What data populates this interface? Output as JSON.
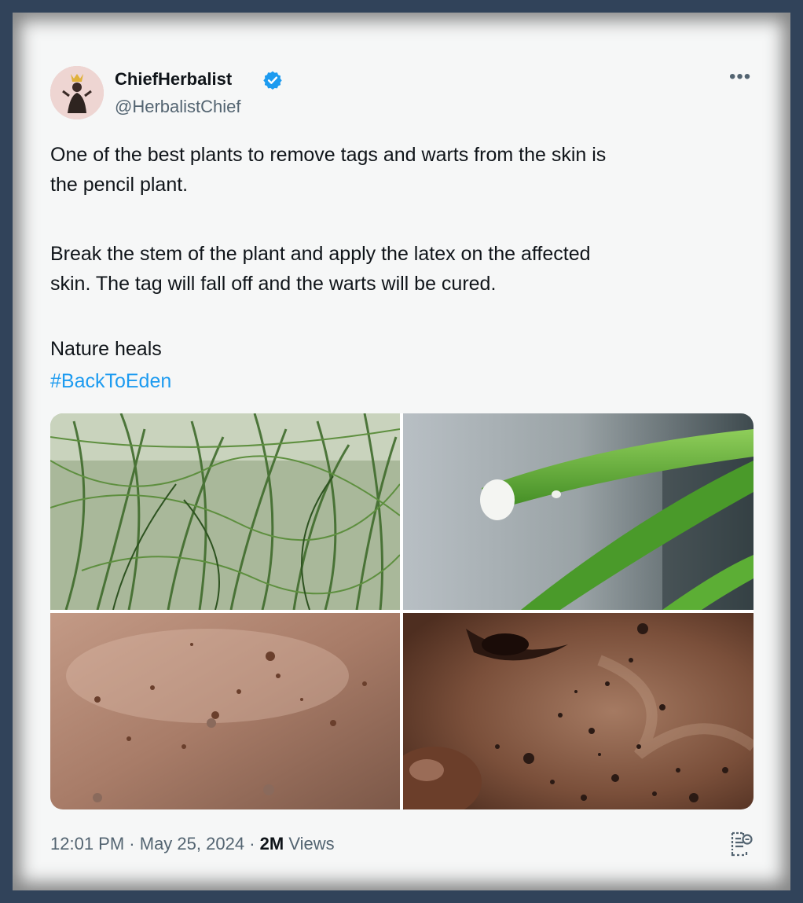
{
  "tweet": {
    "display_name": "ChiefHerbalist",
    "handle": "@HerbalistChief",
    "more_icon": "more-horizontal-icon",
    "paragraphs": [
      "One of the best plants to remove tags and warts from the skin is\nthe pencil plant.",
      "Break the stem of the plant and apply the latex on the affected\nskin. The tag will fall off and the warts will be cured.",
      "Nature heals"
    ],
    "hashtag": "#BackToEden",
    "time": "12:01 PM",
    "date": "May 25, 2024",
    "separator": "·",
    "views_count": "2M",
    "views_label": "Views",
    "colors": {
      "hashtag": "#1d9bf0",
      "verified": "#1d9bf0",
      "secondary_text": "#536471"
    }
  }
}
